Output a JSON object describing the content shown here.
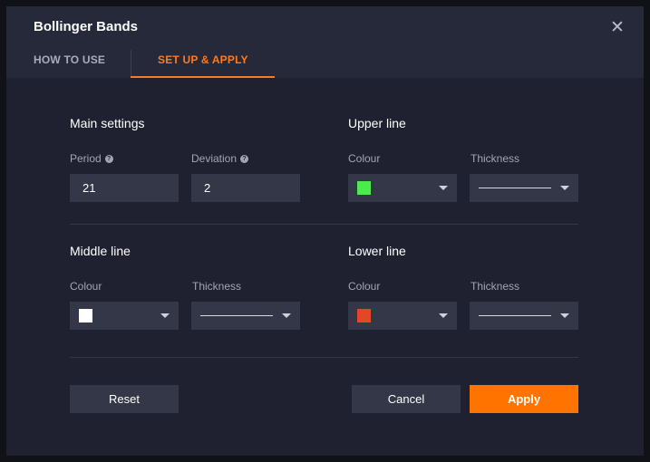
{
  "dialog": {
    "title": "Bollinger Bands",
    "close_icon": "close-icon"
  },
  "tabs": [
    {
      "label": "HOW TO USE",
      "active": false
    },
    {
      "label": "SET UP & APPLY",
      "active": true
    }
  ],
  "colors": {
    "accent": "#ff7400",
    "upper_line": "#4cea4c",
    "middle_line": "#ffffff",
    "lower_line": "#e2472a"
  },
  "main_settings": {
    "title": "Main settings",
    "period_label": "Period",
    "period_value": "21",
    "deviation_label": "Deviation",
    "deviation_value": "2",
    "help_icon": "question-icon"
  },
  "upper_line": {
    "title": "Upper line",
    "colour_label": "Colour",
    "thickness_label": "Thickness"
  },
  "middle_line": {
    "title": "Middle line",
    "colour_label": "Colour",
    "thickness_label": "Thickness"
  },
  "lower_line": {
    "title": "Lower line",
    "colour_label": "Colour",
    "thickness_label": "Thickness"
  },
  "buttons": {
    "reset": "Reset",
    "cancel": "Cancel",
    "apply": "Apply"
  }
}
